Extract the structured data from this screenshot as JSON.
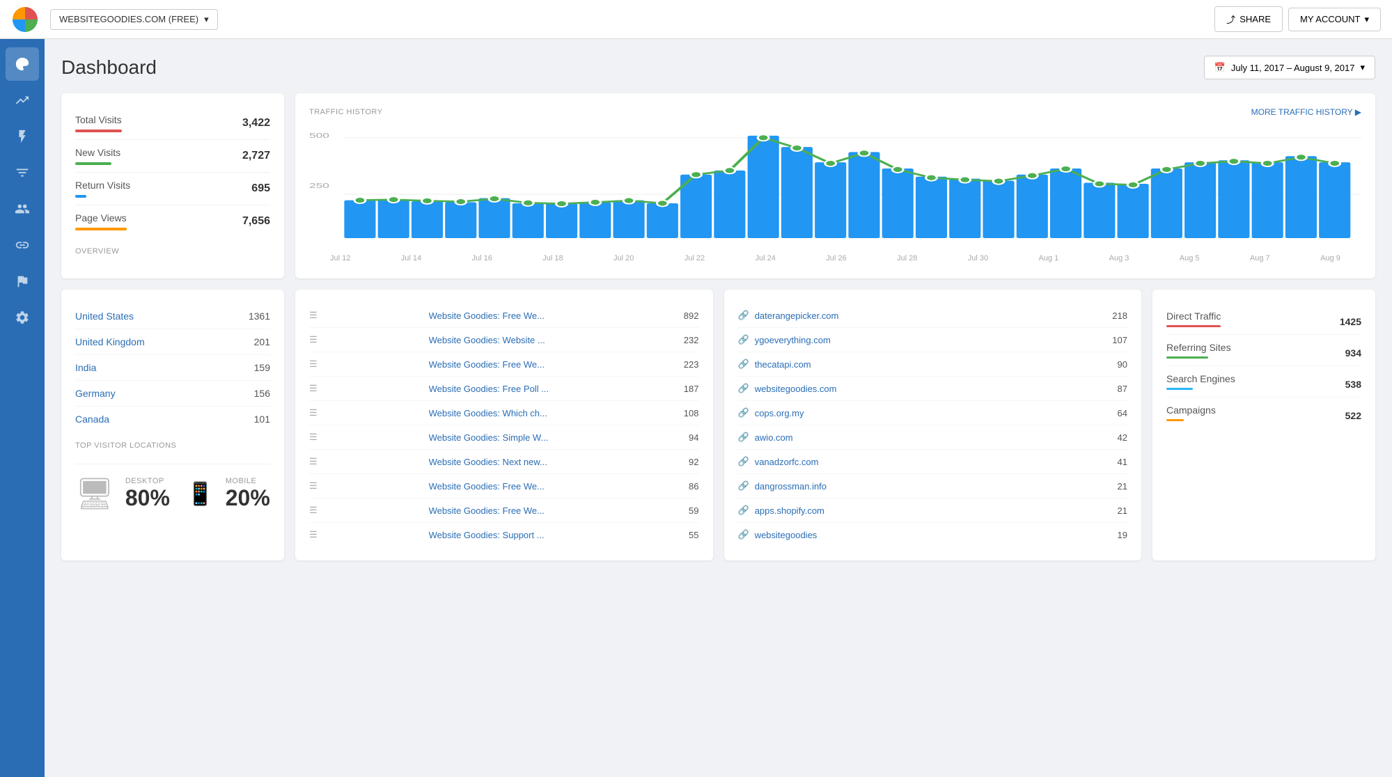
{
  "topbar": {
    "site_selector": "WEBSITEGOODIES.COM (FREE)",
    "share_label": "SHARE",
    "account_label": "MY ACCOUNT"
  },
  "sidebar": {
    "icons": [
      {
        "name": "palette-icon",
        "symbol": "🎨",
        "active": true
      },
      {
        "name": "heart-icon",
        "symbol": "♥",
        "active": false
      },
      {
        "name": "lightning-icon",
        "symbol": "⚡",
        "active": false
      },
      {
        "name": "filter-icon",
        "symbol": "▼",
        "active": false
      },
      {
        "name": "users-icon",
        "symbol": "👥",
        "active": false
      },
      {
        "name": "link-icon",
        "symbol": "🔗",
        "active": false
      },
      {
        "name": "flag-icon",
        "symbol": "⚑",
        "active": false
      },
      {
        "name": "settings-icon",
        "symbol": "⚙",
        "active": false
      }
    ]
  },
  "header": {
    "title": "Dashboard",
    "date_range": "July 11, 2017 – August 9, 2017"
  },
  "overview": {
    "section_label": "OVERVIEW",
    "items": [
      {
        "label": "Total Visits",
        "value": "3,422",
        "color": "#e05252",
        "width": "100%"
      },
      {
        "label": "New Visits",
        "value": "2,727",
        "color": "#4caf50",
        "width": "80%"
      },
      {
        "label": "Return Visits",
        "value": "695",
        "color": "#2196f3",
        "width": "20%"
      },
      {
        "label": "Page Views",
        "value": "7,656",
        "color": "#ff9800",
        "width": "100%"
      }
    ]
  },
  "traffic_history": {
    "section_label": "TRAFFIC HISTORY",
    "more_link": "MORE TRAFFIC HISTORY ▶",
    "y_labels": [
      "500",
      "250"
    ],
    "x_labels": [
      "Jul 12",
      "Jul 14",
      "Jul 16",
      "Jul 18",
      "Jul 20",
      "Jul 22",
      "Jul 24",
      "Jul 26",
      "Jul 28",
      "Jul 30",
      "Aug 1",
      "Aug 3",
      "Aug 5",
      "Aug 7",
      "Aug 9"
    ],
    "bars": [
      185,
      190,
      180,
      175,
      195,
      170,
      170,
      175,
      185,
      170,
      310,
      330,
      500,
      445,
      370,
      420,
      340,
      300,
      290,
      280,
      310,
      340,
      270,
      265,
      340,
      370,
      380,
      370,
      400,
      370
    ],
    "line_points": [
      185,
      188,
      182,
      178,
      192,
      172,
      168,
      175,
      183,
      170,
      310,
      330,
      490,
      440,
      365,
      415,
      335,
      295,
      285,
      278,
      305,
      338,
      265,
      260,
      335,
      365,
      375,
      365,
      395,
      365
    ]
  },
  "locations": {
    "section_label": "TOP VISITOR LOCATIONS",
    "items": [
      {
        "name": "United States",
        "value": "1361"
      },
      {
        "name": "United Kingdom",
        "value": "201"
      },
      {
        "name": "India",
        "value": "159"
      },
      {
        "name": "Germany",
        "value": "156"
      },
      {
        "name": "Canada",
        "value": "101"
      }
    ]
  },
  "top_pages": {
    "items": [
      {
        "name": "Website Goodies: Free We...",
        "value": "892"
      },
      {
        "name": "Website Goodies: Website ...",
        "value": "232"
      },
      {
        "name": "Website Goodies: Free We...",
        "value": "223"
      },
      {
        "name": "Website Goodies: Free Poll ...",
        "value": "187"
      },
      {
        "name": "Website Goodies: Which ch...",
        "value": "108"
      },
      {
        "name": "Website Goodies: Simple W...",
        "value": "94"
      },
      {
        "name": "Website Goodies: Next new...",
        "value": "92"
      },
      {
        "name": "Website Goodies: Free We...",
        "value": "86"
      },
      {
        "name": "Website Goodies: Free We...",
        "value": "59"
      },
      {
        "name": "Website Goodies: Support ...",
        "value": "55"
      }
    ]
  },
  "referrers": {
    "items": [
      {
        "name": "daterangepicker.com",
        "value": "218"
      },
      {
        "name": "ygoeverything.com",
        "value": "107"
      },
      {
        "name": "thecatapi.com",
        "value": "90"
      },
      {
        "name": "websitegoodies.com",
        "value": "87"
      },
      {
        "name": "cops.org.my",
        "value": "64"
      },
      {
        "name": "awio.com",
        "value": "42"
      },
      {
        "name": "vanadzorfc.com",
        "value": "41"
      },
      {
        "name": "dangrossman.info",
        "value": "21"
      },
      {
        "name": "apps.shopify.com",
        "value": "21"
      },
      {
        "name": "websitegoodies",
        "value": "19"
      }
    ]
  },
  "traffic_sources": {
    "items": [
      {
        "name": "Direct Traffic",
        "value": "1425",
        "color": "#e05252",
        "width": "100%"
      },
      {
        "name": "Referring Sites",
        "value": "934",
        "color": "#4caf50",
        "width": "65%"
      },
      {
        "name": "Search Engines",
        "value": "538",
        "color": "#29b6f6",
        "width": "38%"
      },
      {
        "name": "Campaigns",
        "value": "522",
        "color": "#ff9800",
        "width": "36%"
      }
    ]
  },
  "devices": {
    "desktop_label": "DESKTOP",
    "desktop_pct": "80%",
    "mobile_label": "MOBILE",
    "mobile_pct": "20%"
  }
}
